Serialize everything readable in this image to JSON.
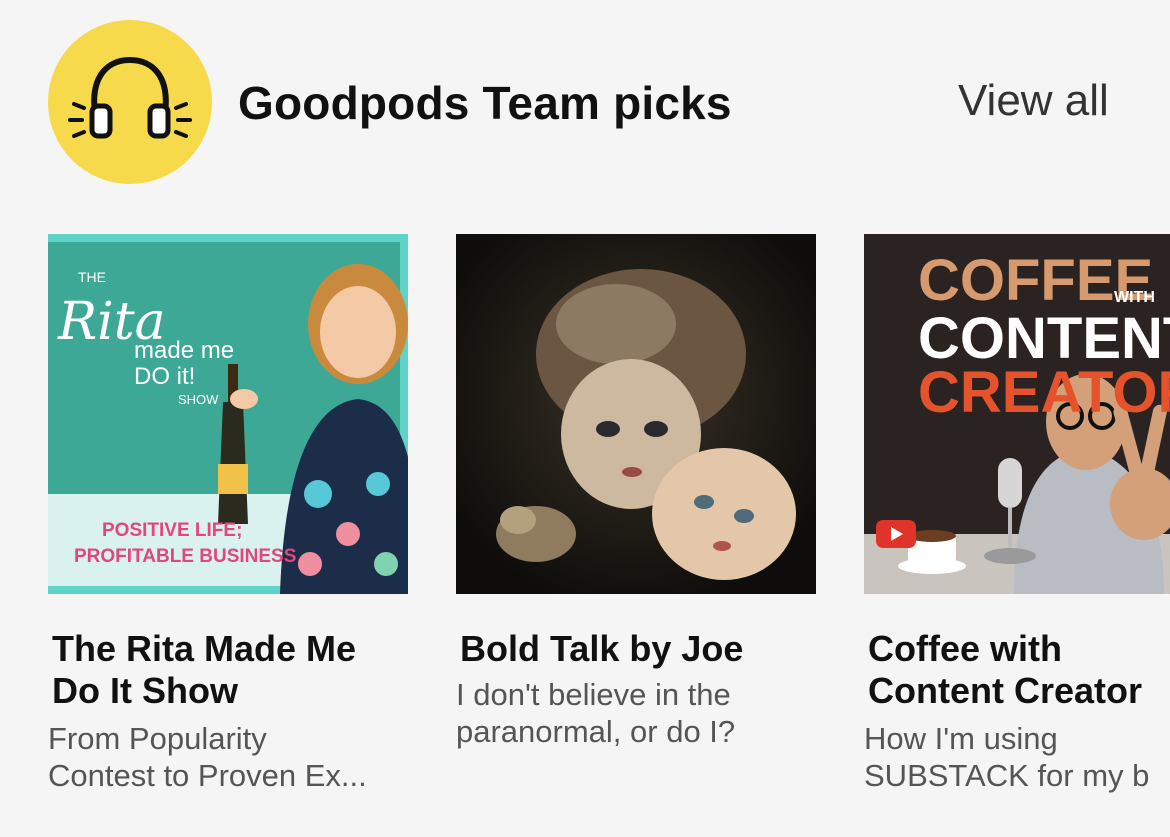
{
  "header": {
    "title": "Goodpods Team picks",
    "view_all_label": "View all",
    "logo_icon": "headphones-icon",
    "logo_color": "#f7d94c"
  },
  "cards": [
    {
      "title": "The Rita Made Me\nDo It Show",
      "subtitle": "From Popularity\nContest to Proven Ex...",
      "art": {
        "the": "THE",
        "rita": "Rita",
        "made_me": "made me",
        "do_it": "DO it!",
        "show": "SHOW",
        "tagline_1": "POSITIVE LIFE;",
        "tagline_2": "PROFITABLE BUSINESS"
      }
    },
    {
      "title": "Bold Talk by Joe",
      "subtitle": "I don't believe in the\nparanormal, or do I?"
    },
    {
      "title": "Coffee with\nContent Creator",
      "subtitle": "How I'm using\nSUBSTACK for my b",
      "art": {
        "coffee": "COFFEE",
        "with": "WITH",
        "content": "CONTENT",
        "creators": "CREATORS"
      }
    }
  ]
}
